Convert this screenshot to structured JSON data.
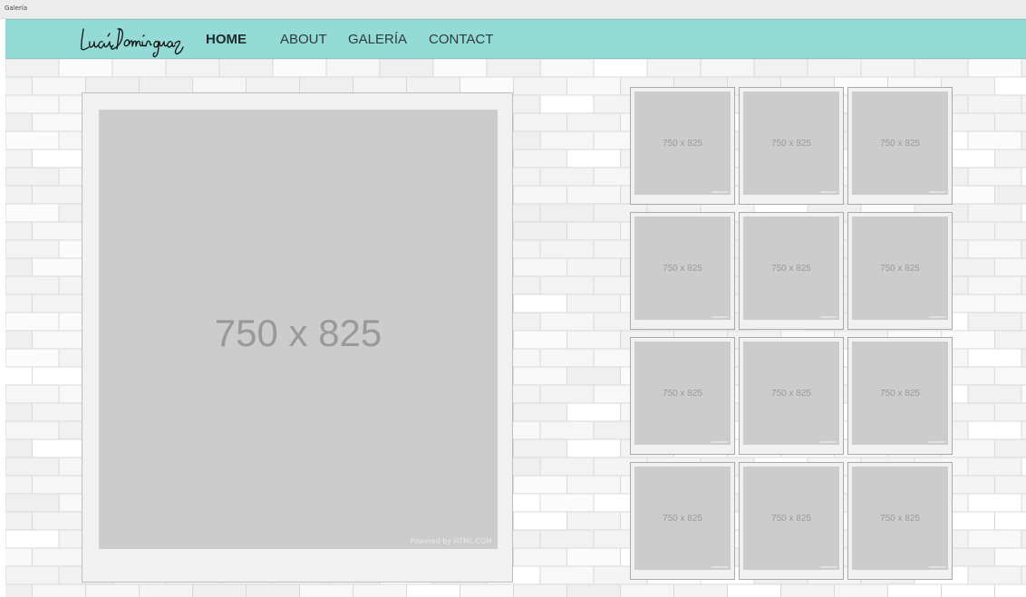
{
  "window": {
    "title": "Galería"
  },
  "brand": {
    "logo_text": "Lucía Domínguez"
  },
  "nav": {
    "items": [
      {
        "label": "HOME",
        "active": true
      },
      {
        "label": "ABOUT",
        "active": false
      },
      {
        "label": "GALERÍA",
        "active": false
      },
      {
        "label": "CONTACT",
        "active": false
      }
    ]
  },
  "colors": {
    "navbar": "#94dad6",
    "wall": "#f5f5f5",
    "frame": "#f1f1f1",
    "placeholder": "#cccccc"
  },
  "featured": {
    "placeholder": "750 x 825",
    "credit": "Powered by HTML.COM"
  },
  "gallery": {
    "thumbs": [
      "750 x 825",
      "750 x 825",
      "750 x 825",
      "750 x 825",
      "750 x 825",
      "750 x 825",
      "750 x 825",
      "750 x 825",
      "750 x 825",
      "750 x 825",
      "750 x 825",
      "750 x 825"
    ]
  }
}
